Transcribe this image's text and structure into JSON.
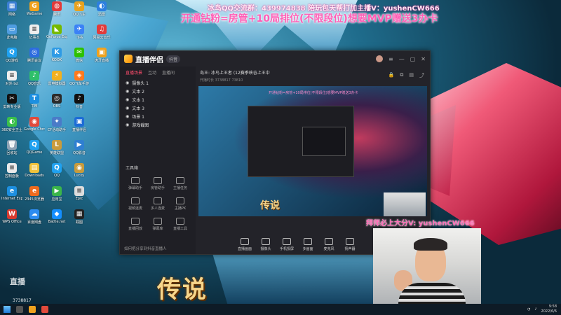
{
  "overlay": {
    "line1": "冰鸟QQ交流群：439974838 陪玩包天帮打加主播V：yushenCW666",
    "line2": "开通钻粉=房管+10局排位(不限段位)想要MVP赠送3办卡",
    "line3": "拜师必上大分V: yushenCW666",
    "legend_text": "传说",
    "preview_legend": "传说"
  },
  "desktop_icons": [
    {
      "label": "网络",
      "color": "#3b7fd4",
      "glyph": "▦"
    },
    {
      "label": "此电脑",
      "color": "#4f9de0",
      "glyph": "▭"
    },
    {
      "label": "QQ游戏",
      "color": "#1fa1f0",
      "glyph": "Q"
    },
    {
      "label": "对外.txt",
      "color": "#eeeeee",
      "glyph": "≡"
    },
    {
      "label": "剪映专业版",
      "color": "#111111",
      "glyph": "✂"
    },
    {
      "label": "360安全卫士",
      "color": "#3ac04a",
      "glyph": "◐"
    },
    {
      "label": "回收站",
      "color": "#8fa3b5",
      "glyph": "🗑"
    },
    {
      "label": "控制面板",
      "color": "#eaeaea",
      "glyph": "≡"
    },
    {
      "label": "Internet Explorer",
      "color": "#1d8fe0",
      "glyph": "e"
    },
    {
      "label": "WPS Office",
      "color": "#d63a2f",
      "glyph": "W"
    },
    {
      "label": "WeGame",
      "color": "#f0a21e",
      "glyph": "G"
    },
    {
      "label": "记事本",
      "color": "#eeeeee",
      "glyph": "≡"
    },
    {
      "label": "腾讯会议",
      "color": "#2d6cdf",
      "glyph": "◎"
    },
    {
      "label": "QQ音乐",
      "color": "#2fbf6a",
      "glyph": "♪"
    },
    {
      "label": "TIM",
      "color": "#1d8fe0",
      "glyph": "T"
    },
    {
      "label": "Google Chrome",
      "color": "#e24a3b",
      "glyph": "◉"
    },
    {
      "label": "QQGame",
      "color": "#1fa1f0",
      "glyph": "Q"
    },
    {
      "label": "Downloads",
      "color": "#f0c23b",
      "glyph": "▤"
    },
    {
      "label": "2345浏览器",
      "color": "#ef6b1e",
      "glyph": "e"
    },
    {
      "label": "百度网盘",
      "color": "#2d8cf0",
      "glyph": "☁"
    },
    {
      "label": "腾讯",
      "color": "#e23a3a",
      "glyph": "◍"
    },
    {
      "label": "GeForce Experience",
      "color": "#76b900",
      "glyph": "◣"
    },
    {
      "label": "KOOK",
      "color": "#2f9be5",
      "glyph": "K"
    },
    {
      "label": "雷电模拟器",
      "color": "#f2b01e",
      "glyph": "⚡"
    },
    {
      "label": "OBS",
      "color": "#2b2b2b",
      "glyph": "◎"
    },
    {
      "label": "CF活动助手",
      "color": "#4a7bc8",
      "glyph": "✦"
    },
    {
      "label": "英雄联盟",
      "color": "#c89b3c",
      "glyph": "L"
    },
    {
      "label": "QQ",
      "color": "#1fa1f0",
      "glyph": "Q"
    },
    {
      "label": "应用宝",
      "color": "#3bb54a",
      "glyph": "▶"
    },
    {
      "label": "Battle.net",
      "color": "#148eff",
      "glyph": "◆"
    },
    {
      "label": "QQ飞车",
      "color": "#e8a21e",
      "glyph": "✈"
    },
    {
      "label": "飞书",
      "color": "#3b82f6",
      "glyph": "✈"
    },
    {
      "label": "微信",
      "color": "#2dc100",
      "glyph": "✉"
    },
    {
      "label": "QQ飞车手游",
      "color": "#ff7a1e",
      "glyph": "◈"
    },
    {
      "label": "抖音",
      "color": "#111111",
      "glyph": "♪"
    },
    {
      "label": "直播伴侣",
      "color": "#1d6cd6",
      "glyph": "▣"
    },
    {
      "label": "QQ影音",
      "color": "#2f7fd1",
      "glyph": "▶"
    },
    {
      "label": "Lucky",
      "color": "#c89b3c",
      "glyph": "◉"
    },
    {
      "label": "Epic",
      "color": "#dddddd",
      "glyph": "≡"
    },
    {
      "label": "截图",
      "color": "#222222",
      "glyph": "▦"
    },
    {
      "label": "迅雷",
      "color": "#2d7fe0",
      "glyph": "◐"
    },
    {
      "label": "网易云音乐",
      "color": "#e23a3a",
      "glyph": "♫"
    },
    {
      "label": "虎牙直播",
      "color": "#f0a21e",
      "glyph": "▣"
    }
  ],
  "app": {
    "name": "直播伴侣",
    "tag": "抖音",
    "tabs": [
      "直播场景",
      "互动",
      "直播间"
    ],
    "scenes": [
      "摄像头 1",
      "文本 2",
      "文本 1",
      "文本 3",
      "场景 1",
      "游戏截图"
    ],
    "tools_title": "工具箱",
    "tools": [
      "弹幕助手",
      "房管助手",
      "主播任务",
      "视频连麦",
      "多人连麦",
      "主播PK",
      "直播回放",
      "弹幕库",
      "直播工具"
    ],
    "bottom_notice": "如何把分享到抖音直播人",
    "stream_title": "岛王: 冰鸟上王者 (12赛季峡谷上王中",
    "stream_meta": "开播时长 3738817  73810",
    "preview_banner": "开通钻粉=房管+10局排位(不限段位)想要MVP赠送3办卡",
    "bottom_tools": [
      "直播画面",
      "摄像头",
      "手机投屏",
      "多画面",
      "麦克风",
      "扬声器"
    ]
  },
  "taskbar": {
    "time": "9:58",
    "date": "2022/6/6"
  },
  "watermark": {
    "main": "直播",
    "sub": "3738817"
  }
}
